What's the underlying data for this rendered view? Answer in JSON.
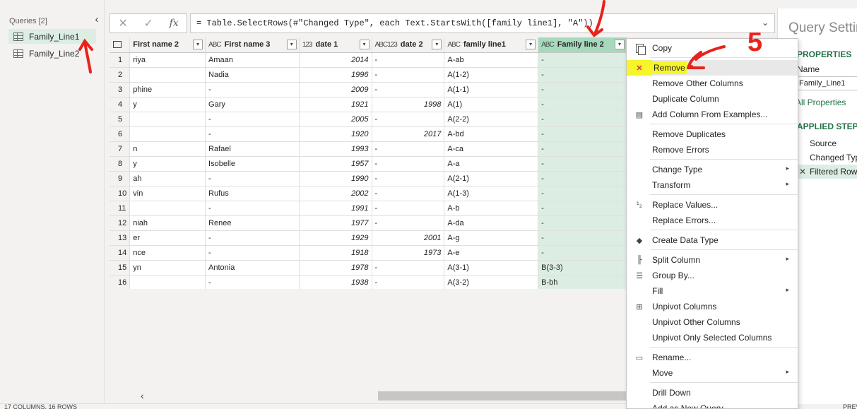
{
  "queries": {
    "header": "Queries [2]",
    "collapse_glyph": "‹",
    "items": [
      {
        "label": "Family_Line1",
        "icon": "table-icon",
        "selected": true
      },
      {
        "label": "Family_Line2",
        "icon": "table-icon",
        "selected": false
      }
    ]
  },
  "formula": {
    "cancel_glyph": "✕",
    "commit_glyph": "✓",
    "fx_glyph": "fx",
    "text": "= Table.SelectRows(#\"Changed Type\", each Text.StartsWith([family line1], \"A\"))",
    "expand_glyph": "⌄"
  },
  "grid": {
    "columns": [
      {
        "label": "First name 2",
        "type": "",
        "dd": "▾"
      },
      {
        "label": "First name 3",
        "type": "ABC",
        "dd": "▾"
      },
      {
        "label": "date 1",
        "type": "123",
        "dd": "▾"
      },
      {
        "label": "date 2",
        "type": "ABC123",
        "dd": "▾"
      },
      {
        "label": "family line1",
        "type": "ABC",
        "dd": "▾"
      },
      {
        "label": "Family line 2",
        "type": "ABC",
        "dd": "▾"
      }
    ],
    "rows": [
      {
        "n": "1",
        "c1": "riya",
        "c2": "Amaan",
        "c3": "2014",
        "c4": "-",
        "c5": "A-ab",
        "c6": "-"
      },
      {
        "n": "2",
        "c1": "",
        "c2": "Nadia",
        "c3": "1996",
        "c4": "-",
        "c5": "A(1-2)",
        "c6": "-"
      },
      {
        "n": "3",
        "c1": "phine",
        "c2": "-",
        "c3": "2009",
        "c4": "-",
        "c5": "A(1-1)",
        "c6": "-"
      },
      {
        "n": "4",
        "c1": "y",
        "c2": "Gary",
        "c3": "1921",
        "c4": "1998",
        "c5": "A(1)",
        "c6": "-"
      },
      {
        "n": "5",
        "c1": "",
        "c2": "-",
        "c3": "2005",
        "c4": "-",
        "c5": "A(2-2)",
        "c6": "-"
      },
      {
        "n": "6",
        "c1": "",
        "c2": "-",
        "c3": "1920",
        "c4": "2017",
        "c5": "A-bd",
        "c6": "-"
      },
      {
        "n": "7",
        "c1": "n",
        "c2": "Rafael",
        "c3": "1993",
        "c4": "-",
        "c5": "A-ca",
        "c6": "-"
      },
      {
        "n": "8",
        "c1": "y",
        "c2": "Isobelle",
        "c3": "1957",
        "c4": "-",
        "c5": "A-a",
        "c6": "-"
      },
      {
        "n": "9",
        "c1": "ah",
        "c2": "-",
        "c3": "1990",
        "c4": "-",
        "c5": "A(2-1)",
        "c6": "-"
      },
      {
        "n": "10",
        "c1": "vin",
        "c2": "Rufus",
        "c3": "2002",
        "c4": "-",
        "c5": "A(1-3)",
        "c6": "-"
      },
      {
        "n": "11",
        "c1": "",
        "c2": "-",
        "c3": "1991",
        "c4": "-",
        "c5": "A-b",
        "c6": "-"
      },
      {
        "n": "12",
        "c1": "niah",
        "c2": "Renee",
        "c3": "1977",
        "c4": "-",
        "c5": "A-da",
        "c6": "-"
      },
      {
        "n": "13",
        "c1": "er",
        "c2": "-",
        "c3": "1929",
        "c4": "2001",
        "c5": "A-g",
        "c6": "-"
      },
      {
        "n": "14",
        "c1": "nce",
        "c2": "-",
        "c3": "1918",
        "c4": "1973",
        "c5": "A-e",
        "c6": "-"
      },
      {
        "n": "15",
        "c1": "yn",
        "c2": "Antonia",
        "c3": "1978",
        "c4": "-",
        "c5": "A(3-1)",
        "c6": "B(3-3)"
      },
      {
        "n": "16",
        "c1": "",
        "c2": "-",
        "c3": "1938",
        "c4": "-",
        "c5": "A(3-2)",
        "c6": "B-bh"
      }
    ]
  },
  "hscroll": {
    "left_glyph": "‹"
  },
  "status": {
    "left": "17 COLUMNS, 16 ROWS",
    "right": "PREV"
  },
  "settings": {
    "title": "Query Settings",
    "properties": "PROPERTIES",
    "name_label": "Name",
    "name_value": "Family_Line1",
    "all_properties": "All Properties",
    "applied_steps": "APPLIED STEPS",
    "steps": [
      {
        "label": "Source",
        "active": false
      },
      {
        "label": "Changed Type",
        "active": false
      },
      {
        "label": "Filtered Rows",
        "active": true
      }
    ],
    "delete_step_glyph": "✕"
  },
  "menu": {
    "items": [
      {
        "label": "Copy",
        "icon": "copy-icon"
      },
      {
        "label": "Remove",
        "icon": "remove-icon",
        "highlight": true
      },
      {
        "label": "Remove Other Columns",
        "icon": ""
      },
      {
        "label": "Duplicate Column",
        "icon": ""
      },
      {
        "label": "Add Column From Examples...",
        "icon": "add-column-examples-icon"
      },
      {
        "label": "Remove Duplicates",
        "icon": ""
      },
      {
        "label": "Remove Errors",
        "icon": ""
      },
      {
        "label": "Change Type",
        "icon": "",
        "sub": "▸"
      },
      {
        "label": "Transform",
        "icon": "",
        "sub": "▸"
      },
      {
        "label": "Replace Values...",
        "icon": "replace-values-icon"
      },
      {
        "label": "Replace Errors...",
        "icon": ""
      },
      {
        "label": "Create Data Type",
        "icon": "create-data-type-icon"
      },
      {
        "label": "Split Column",
        "icon": "split-column-icon",
        "sub": "▸"
      },
      {
        "label": "Group By...",
        "icon": "group-by-icon"
      },
      {
        "label": "Fill",
        "icon": "",
        "sub": "▸"
      },
      {
        "label": "Unpivot Columns",
        "icon": "unpivot-icon"
      },
      {
        "label": "Unpivot Other Columns",
        "icon": ""
      },
      {
        "label": "Unpivot Only Selected Columns",
        "icon": ""
      },
      {
        "label": "Rename...",
        "icon": "rename-icon"
      },
      {
        "label": "Move",
        "icon": "",
        "sub": "▸"
      },
      {
        "label": "Drill Down",
        "icon": ""
      },
      {
        "label": "Add as New Query",
        "icon": ""
      }
    ]
  },
  "annotation": {
    "step_number": "5",
    "color": "#e8231b"
  },
  "colors": {
    "accent_green": "#217346",
    "selected_green": "#dceee4",
    "highlight_yellow": "#f5f52a"
  }
}
